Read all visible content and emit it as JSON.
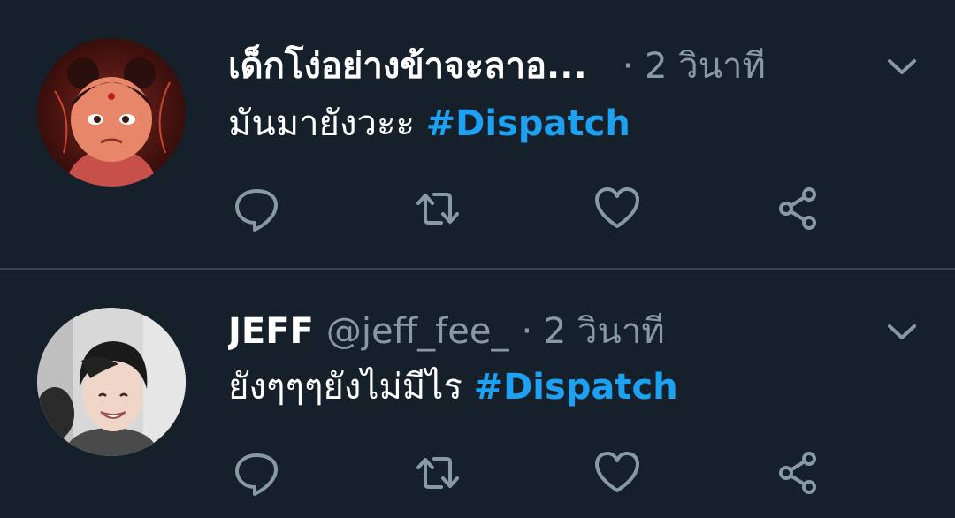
{
  "colors": {
    "background": "#15202b",
    "divider": "#38444d",
    "name": "#ffffff",
    "secondary": "#8899a6",
    "hashtag": "#1da1f2",
    "icon": "#8899a6"
  },
  "tweets": [
    {
      "display_name": "เด็กโง่อย่างข้าจะลาอ...",
      "handle": "",
      "meta": "· 2 วินาที",
      "text": "มันมายังวะะ",
      "hashtag": "#Dispatch",
      "avatar_icon": "avatar-cartoon-icon",
      "actions": [
        "reply-icon",
        "retweet-icon",
        "like-icon",
        "share-icon"
      ]
    },
    {
      "display_name": "JEFF",
      "handle": "@jeff_fee_",
      "meta": "· 2 วินาที",
      "text": "ยังๆๆๆยังไม่มีไร",
      "hashtag": "#Dispatch",
      "avatar_icon": "avatar-photo-icon",
      "actions": [
        "reply-icon",
        "retweet-icon",
        "like-icon",
        "share-icon"
      ]
    }
  ]
}
